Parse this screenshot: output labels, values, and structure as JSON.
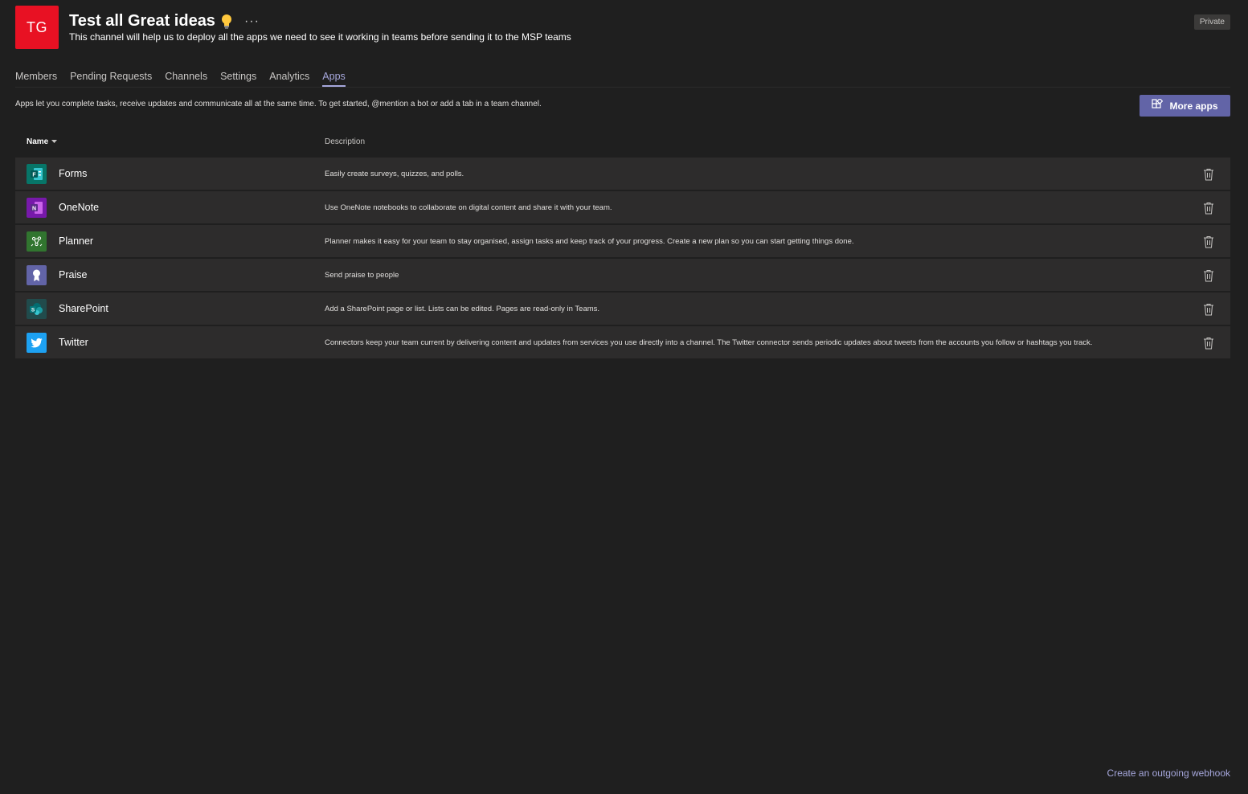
{
  "header": {
    "avatar_initials": "TG",
    "avatar_color": "#e81123",
    "title": "Test all Great ideas",
    "title_icon": "lightbulb-icon",
    "more_options": "···",
    "description": "This channel will help us to deploy all the apps we need to see it working in teams before sending it to the MSP teams",
    "privacy_badge": "Private"
  },
  "tabs": [
    {
      "label": "Members",
      "active": false
    },
    {
      "label": "Pending Requests",
      "active": false
    },
    {
      "label": "Channels",
      "active": false
    },
    {
      "label": "Settings",
      "active": false
    },
    {
      "label": "Analytics",
      "active": false
    },
    {
      "label": "Apps",
      "active": true
    }
  ],
  "apps_page": {
    "info_text": "Apps let you complete tasks, receive updates and communicate all at the same time. To get started, @mention a bot or add a tab in a team channel.",
    "more_apps_label": "More apps",
    "accent_color": "#6264a7",
    "columns": {
      "name": "Name",
      "description": "Description"
    },
    "apps": [
      {
        "name": "Forms",
        "icon": "forms-icon",
        "color": "#077568",
        "description": "Easily create surveys, quizzes, and polls."
      },
      {
        "name": "OneNote",
        "icon": "onenote-icon",
        "color": "#7719aa",
        "description": "Use OneNote notebooks to collaborate on digital content and share it with your team."
      },
      {
        "name": "Planner",
        "icon": "planner-icon",
        "color": "#31752f",
        "description": "Planner makes it easy for your team to stay organised, assign tasks and keep track of your progress. Create a new plan so you can start getting things done."
      },
      {
        "name": "Praise",
        "icon": "praise-icon",
        "color": "#6264a7",
        "description": "Send praise to people"
      },
      {
        "name": "SharePoint",
        "icon": "sharepoint-icon",
        "color": "#036c70",
        "description": "Add a SharePoint page or list. Lists can be edited. Pages are read-only in Teams."
      },
      {
        "name": "Twitter",
        "icon": "twitter-icon",
        "color": "#1da1f2",
        "description": "Connectors keep your team current by delivering content and updates from services you use directly into a channel. The Twitter connector sends periodic updates about tweets from the accounts you follow or hashtags you track."
      }
    ]
  },
  "footer": {
    "webhook_link": "Create an outgoing webhook"
  }
}
